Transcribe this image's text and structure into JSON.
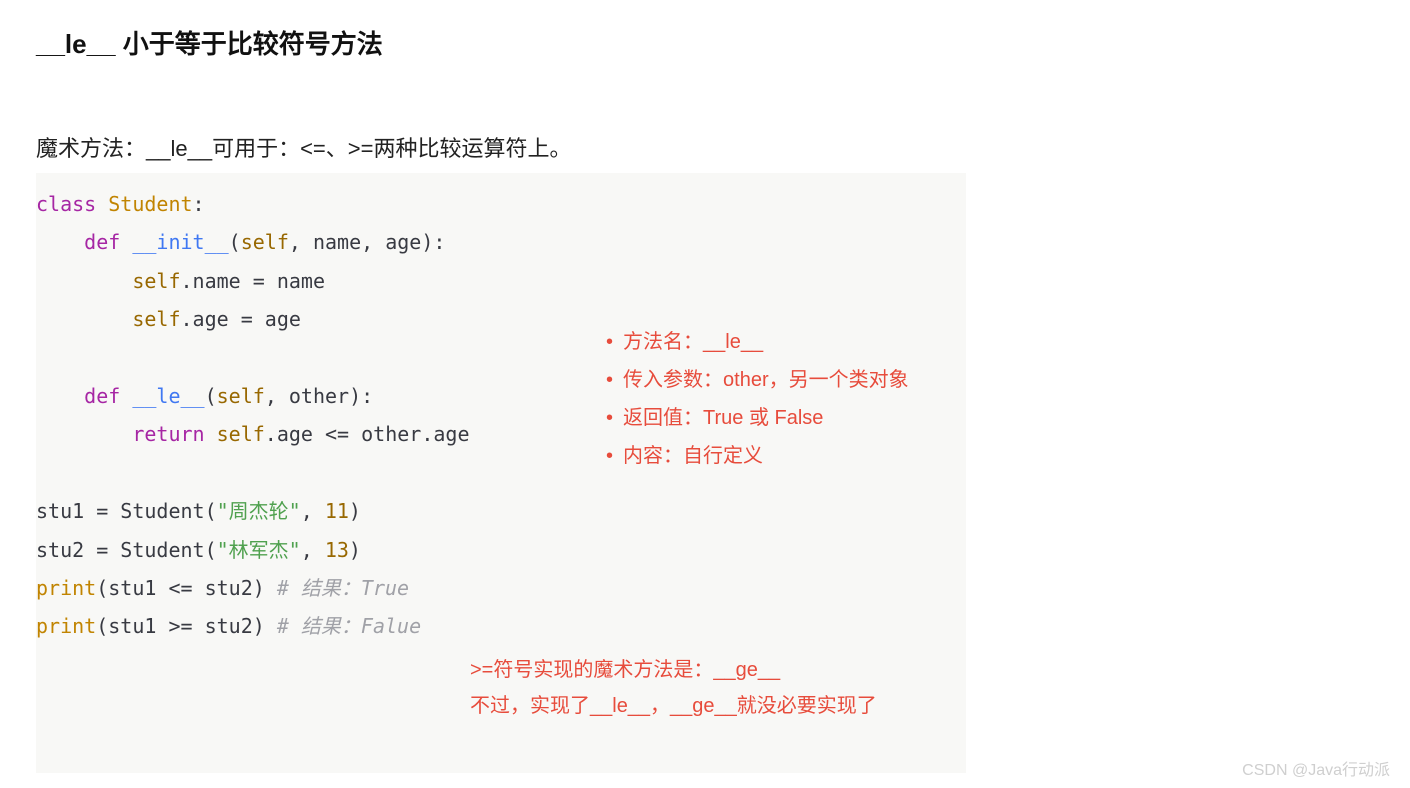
{
  "heading": "__le__ 小于等于比较符号方法",
  "description": "魔术方法：__le__可用于：<=、>=两种比较运算符上。",
  "code": {
    "tokens": [
      [
        {
          "t": "class ",
          "c": "kw"
        },
        {
          "t": "Student",
          "c": "cls"
        },
        {
          "t": ":",
          "c": "plain"
        }
      ],
      [
        {
          "t": "    ",
          "c": "plain"
        },
        {
          "t": "def ",
          "c": "kw"
        },
        {
          "t": "__init__",
          "c": "fn"
        },
        {
          "t": "(",
          "c": "plain"
        },
        {
          "t": "self",
          "c": "self"
        },
        {
          "t": ", name, age):",
          "c": "plain"
        }
      ],
      [
        {
          "t": "        ",
          "c": "plain"
        },
        {
          "t": "self",
          "c": "self"
        },
        {
          "t": ".name = name",
          "c": "plain"
        }
      ],
      [
        {
          "t": "        ",
          "c": "plain"
        },
        {
          "t": "self",
          "c": "self"
        },
        {
          "t": ".age = age",
          "c": "plain"
        }
      ],
      [
        {
          "t": "",
          "c": "plain"
        }
      ],
      [
        {
          "t": "    ",
          "c": "plain"
        },
        {
          "t": "def ",
          "c": "kw"
        },
        {
          "t": "__le__",
          "c": "fn"
        },
        {
          "t": "(",
          "c": "plain"
        },
        {
          "t": "self",
          "c": "self"
        },
        {
          "t": ", other):",
          "c": "plain"
        }
      ],
      [
        {
          "t": "        ",
          "c": "plain"
        },
        {
          "t": "return ",
          "c": "kw"
        },
        {
          "t": "self",
          "c": "self"
        },
        {
          "t": ".age <= other.age",
          "c": "plain"
        }
      ],
      [
        {
          "t": "",
          "c": "plain"
        }
      ],
      [
        {
          "t": "stu1 = Student(",
          "c": "plain"
        },
        {
          "t": "\"周杰轮\"",
          "c": "str"
        },
        {
          "t": ", ",
          "c": "plain"
        },
        {
          "t": "11",
          "c": "num"
        },
        {
          "t": ")",
          "c": "plain"
        }
      ],
      [
        {
          "t": "stu2 = Student(",
          "c": "plain"
        },
        {
          "t": "\"林军杰\"",
          "c": "str"
        },
        {
          "t": ", ",
          "c": "plain"
        },
        {
          "t": "13",
          "c": "num"
        },
        {
          "t": ")",
          "c": "plain"
        }
      ],
      [
        {
          "t": "print",
          "c": "built"
        },
        {
          "t": "(stu1 <= stu2) ",
          "c": "plain"
        },
        {
          "t": "# 结果：True",
          "c": "cmt"
        }
      ],
      [
        {
          "t": "print",
          "c": "built"
        },
        {
          "t": "(stu1 >= stu2) ",
          "c": "plain"
        },
        {
          "t": "# 结果：Falue",
          "c": "cmt"
        }
      ]
    ]
  },
  "annot_side": [
    "方法名：__le__",
    "传入参数：other，另一个类对象",
    "返回值：True 或 False",
    "内容：自行定义"
  ],
  "annot_bottom": [
    ">=符号实现的魔术方法是：__ge__",
    "不过，实现了__le__，__ge__就没必要实现了"
  ],
  "watermark": "CSDN @Java行动派"
}
